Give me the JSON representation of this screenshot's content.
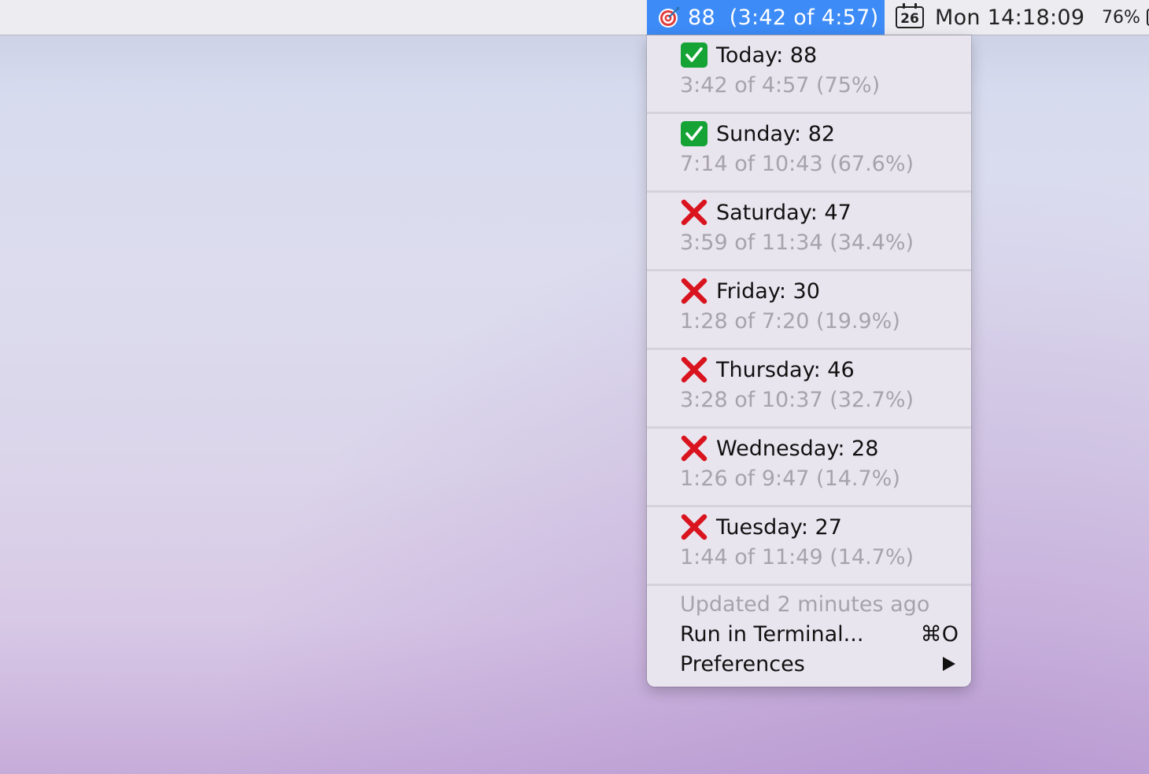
{
  "menubar": {
    "status_text": "88  (3:42 of 4:57)",
    "calendar_day": "26",
    "clock": "Mon 14:18:09",
    "battery": "76%"
  },
  "menu": {
    "days": [
      {
        "title": "Today: 88",
        "detail": "3:42 of 4:57 (75%)",
        "status": "check",
        "status_icon": "check-mark-icon"
      },
      {
        "title": "Sunday: 82",
        "detail": "7:14 of 10:43 (67.6%)",
        "status": "check",
        "status_icon": "check-mark-icon"
      },
      {
        "title": "Saturday: 47",
        "detail": "3:59 of 11:34 (34.4%)",
        "status": "cross",
        "status_icon": "cross-mark-icon"
      },
      {
        "title": "Friday: 30",
        "detail": "1:28 of 7:20 (19.9%)",
        "status": "cross",
        "status_icon": "cross-mark-icon"
      },
      {
        "title": "Thursday: 46",
        "detail": "3:28 of 10:37 (32.7%)",
        "status": "cross",
        "status_icon": "cross-mark-icon"
      },
      {
        "title": "Wednesday: 28",
        "detail": "1:26 of 9:47 (14.7%)",
        "status": "cross",
        "status_icon": "cross-mark-icon"
      },
      {
        "title": "Tuesday: 27",
        "detail": "1:44 of 11:49 (14.7%)",
        "status": "cross",
        "status_icon": "cross-mark-icon"
      }
    ],
    "updated": "Updated 2 minutes ago",
    "run_label": "Run in Terminal...",
    "run_shortcut": "⌘O",
    "preferences_label": "Preferences"
  },
  "colors": {
    "highlight": "#3d8bf6",
    "check_green": "#15a336",
    "cross_red": "#d9141e",
    "secondary_text": "#a6a3ab"
  }
}
